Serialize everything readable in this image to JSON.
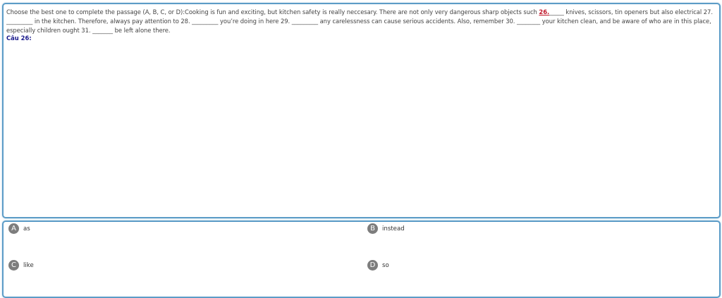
{
  "question": {
    "passage_before": "Choose the best one to complete the passage (A, B, C, or D):Cooking is fun and exciting, but kitchen safety is really neccesary. There are not only very dangerous sharp objects such ",
    "highlight": "26.",
    "passage_after": "_____ knives, scissors, tin openers but also electrical 27. _________ in the kitchen. Therefore, always pay attention to 28. _________ you’re doing in here 29. _________ any carelessness can cause serious accidents. Also, remember 30. ________ your kitchen clean, and be aware of who are in this place, especially children ought 31. _______ be left alone there.",
    "label": "Câu 26:"
  },
  "options": [
    {
      "letter": "A",
      "text": "as"
    },
    {
      "letter": "B",
      "text": "instead"
    },
    {
      "letter": "C",
      "text": "like"
    },
    {
      "letter": "D",
      "text": "so"
    }
  ],
  "colors": {
    "panel_border": "#5c9cc7",
    "highlight": "#c0182b",
    "label": "#1a1a8c",
    "badge": "#7d7d7d"
  }
}
